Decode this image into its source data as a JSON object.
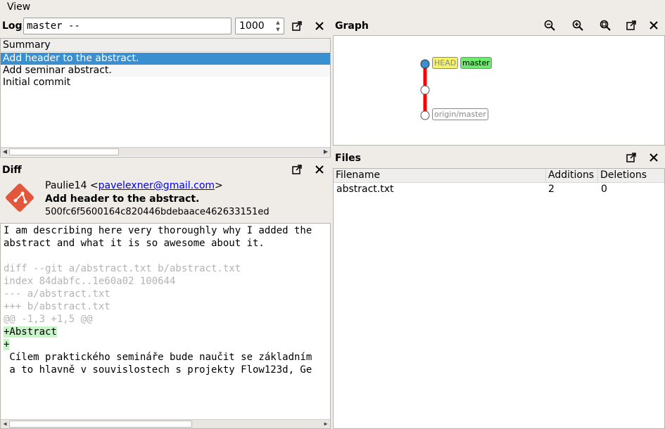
{
  "menu": {
    "view": "View"
  },
  "log": {
    "title": "Log",
    "filter_value": "master --",
    "max_count": "1000",
    "column_header": "Summary",
    "rows": [
      "Add header to the abstract.",
      "Add seminar abstract.",
      "Initial commit"
    ]
  },
  "diff": {
    "title": "Diff",
    "author_name": "Paulie14 <",
    "author_email": "pavelexner@gmail.com",
    "author_close": ">",
    "commit_title": "Add header to the abstract.",
    "commit_sha": "500fc6f5600164c820446bdebaace462633151ed",
    "lines": [
      {
        "text": "I am describing here very thoroughly why I added the",
        "kind": "msg"
      },
      {
        "text": "abstract and what it is so awesome about it.",
        "kind": "msg"
      },
      {
        "text": "",
        "kind": "msg"
      },
      {
        "text": "diff --git a/abstract.txt b/abstract.txt",
        "kind": "meta"
      },
      {
        "text": "index 84dabfc..1e60a02 100644",
        "kind": "meta"
      },
      {
        "text": "--- a/abstract.txt",
        "kind": "meta"
      },
      {
        "text": "+++ b/abstract.txt",
        "kind": "meta"
      },
      {
        "text": "@@ -1,3 +1,5 @@",
        "kind": "meta"
      },
      {
        "text": "+Abstract",
        "kind": "add"
      },
      {
        "text": "+",
        "kind": "add"
      },
      {
        "text": " Cílem praktického semináře bude naučit se základním",
        "kind": "ctx"
      },
      {
        "text": " a to hlavně v souvislostech s projekty Flow123d, Ge",
        "kind": "ctx"
      }
    ]
  },
  "graph": {
    "title": "Graph",
    "labels": {
      "head": "HEAD",
      "master": "master",
      "origin": "origin/master"
    },
    "colors": {
      "head_tag": "#f4f26a",
      "master_tag": "#6ee86e",
      "edge": "#ff0000",
      "head_node": "#3a8fd1"
    }
  },
  "files": {
    "title": "Files",
    "headers": {
      "filename": "Filename",
      "additions": "Additions",
      "deletions": "Deletions"
    },
    "rows": [
      {
        "filename": "abstract.txt",
        "additions": "2",
        "deletions": "0"
      }
    ]
  }
}
